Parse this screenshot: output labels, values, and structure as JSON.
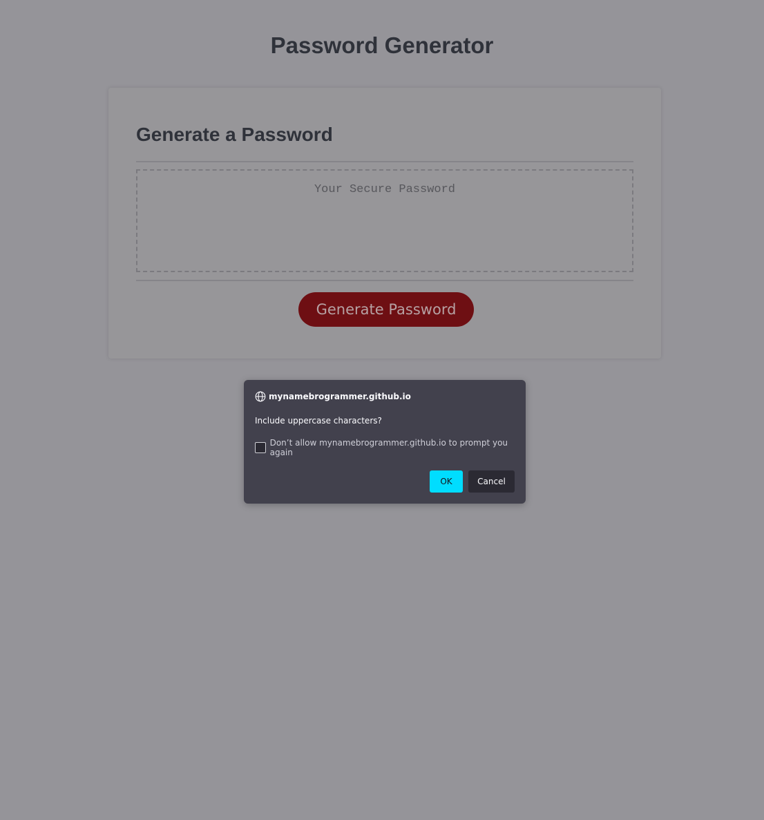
{
  "page": {
    "title": "Password Generator"
  },
  "card": {
    "title": "Generate a Password",
    "password_placeholder": "Your Secure Password",
    "password_value": "",
    "generate_label": "Generate Password"
  },
  "dialog": {
    "origin": "mynamebrogrammer.github.io",
    "origin_icon": "globe-icon",
    "message": "Include uppercase characters?",
    "checkbox_label": "Don’t allow mynamebrogrammer.github.io to prompt you again",
    "checkbox_checked": false,
    "ok_label": "OK",
    "cancel_label": "Cancel"
  },
  "colors": {
    "overlay_background": "#959499",
    "button_primary": "#6e0f13",
    "dialog_background": "#42414d",
    "dialog_ok": "#00ddff"
  }
}
